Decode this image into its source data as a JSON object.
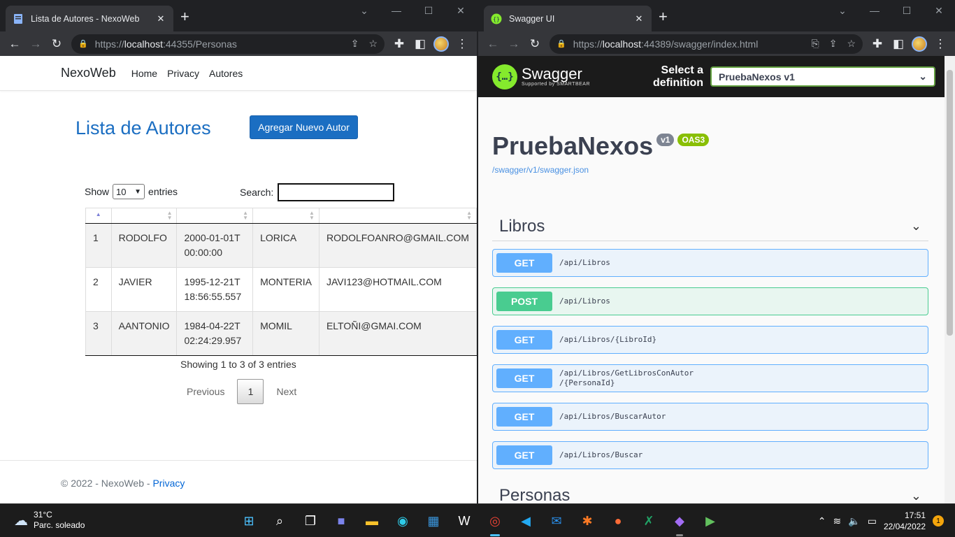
{
  "left_window": {
    "tab_title": "Lista de Autores - NexoWeb",
    "url_scheme": "https://",
    "url_host": "localhost",
    "url_rest": ":44355/Personas",
    "page": {
      "brand": "NexoWeb",
      "nav": [
        "Home",
        "Privacy",
        "Autores"
      ],
      "heading": "Lista de Autores",
      "add_button": "Agregar Nuevo Autor",
      "show_label": "Show",
      "entries_value": "10",
      "entries_label": "entries",
      "search_label": "Search:",
      "rows": [
        [
          "1",
          "RODOLFO",
          "2000-01-01T00:00:00",
          "LORICA",
          "RODOLFOANRO@GMAIL.COM"
        ],
        [
          "2",
          "JAVIER",
          "1995-12-21T18:56:55.557",
          "MONTERIA",
          "JAVI123@HOTMAIL.COM"
        ],
        [
          "3",
          "AANTONIO",
          "1984-04-22T02:24:29.957",
          "MOMIL",
          "ELTOÑI@GMAI.COM"
        ]
      ],
      "info": "Showing 1 to 3 of 3 entries",
      "pager": {
        "previous": "Previous",
        "current": "1",
        "next": "Next"
      },
      "footer_text": "© 2022 - NexoWeb - ",
      "footer_link": "Privacy"
    }
  },
  "right_window": {
    "tab_title": "Swagger UI",
    "url_scheme": "https://",
    "url_host": "localhost",
    "url_rest": ":44389/swagger/index.html",
    "page": {
      "logo_text": "Swagger",
      "logo_sub": "Supported by SMARTBEAR",
      "select_label_1": "Select a",
      "select_label_2": "definition",
      "definition": "PruebaNexos v1",
      "title": "PruebaNexos",
      "version_badge": "v1",
      "oas_badge": "OAS3",
      "json_link": "/swagger/v1/swagger.json",
      "tags": [
        "Libros",
        "Personas"
      ],
      "operations": [
        {
          "method": "GET",
          "path": "/api/Libros"
        },
        {
          "method": "POST",
          "path": "/api/Libros"
        },
        {
          "method": "GET",
          "path": "/api/Libros/{LibroId}"
        },
        {
          "method": "GET",
          "path": "/api/Libros/GetLibrosConAutor\n/{PersonaId}"
        },
        {
          "method": "GET",
          "path": "/api/Libros/BuscarAutor"
        },
        {
          "method": "GET",
          "path": "/api/Libros/Buscar"
        }
      ]
    }
  },
  "taskbar": {
    "temperature": "31°C",
    "weather": "Parc. soleado",
    "time": "17:51",
    "date": "22/04/2022",
    "notifications": "1",
    "apps": [
      "start-icon",
      "search-icon",
      "task-view-icon",
      "teams-chat-icon",
      "file-explorer-icon",
      "edge-icon",
      "store-icon",
      "wikipedia-icon",
      "chrome-icon",
      "vscode-icon",
      "mail-icon",
      "xampp-icon",
      "postman-icon",
      "excel-icon",
      "visual-studio-icon",
      "media-player-icon"
    ]
  }
}
